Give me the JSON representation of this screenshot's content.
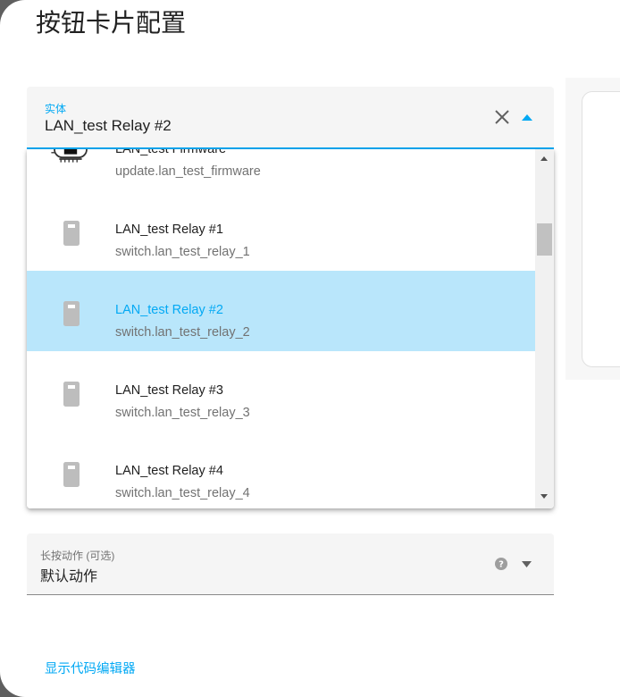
{
  "dialog": {
    "title": "按钮卡片配置"
  },
  "entity_field": {
    "label": "实体",
    "value": "LAN_test Relay #2"
  },
  "dropdown": {
    "items": [
      {
        "name": "LAN_test Firmware",
        "entity_id": "update.lan_test_firmware",
        "icon": "firmware-house-icon",
        "selected": false
      },
      {
        "name": "LAN_test Relay #1",
        "entity_id": "switch.lan_test_relay_1",
        "icon": "light-switch-icon",
        "selected": false
      },
      {
        "name": "LAN_test Relay #2",
        "entity_id": "switch.lan_test_relay_2",
        "icon": "light-switch-icon",
        "selected": true
      },
      {
        "name": "LAN_test Relay #3",
        "entity_id": "switch.lan_test_relay_3",
        "icon": "light-switch-icon",
        "selected": false
      },
      {
        "name": "LAN_test Relay #4",
        "entity_id": "switch.lan_test_relay_4",
        "icon": "light-switch-icon",
        "selected": false
      }
    ]
  },
  "hold_action_field": {
    "label": "长按动作 (可选)",
    "value": "默认动作"
  },
  "footer": {
    "show_code_editor": "显示代码编辑器"
  },
  "colors": {
    "accent": "#03a9f4",
    "selected_bg": "#b9e6fb",
    "field_bg": "#f5f5f5",
    "icon_gray": "#bdbdbd"
  }
}
